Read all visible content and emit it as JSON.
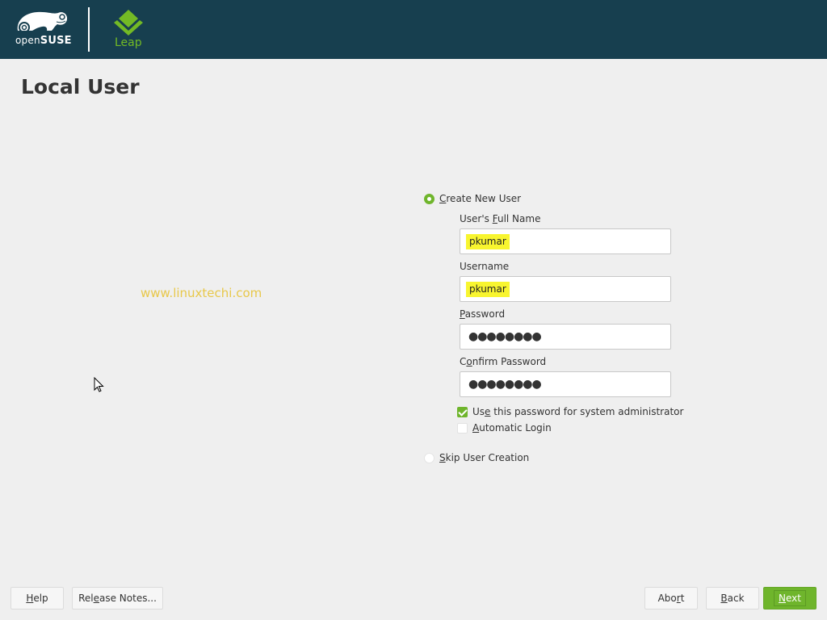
{
  "header": {
    "brand_name_prefix": "open",
    "brand_name_suffix": "SUSE",
    "product_name": "Leap",
    "background_color": "#173f4f",
    "accent_color": "#73ba25"
  },
  "page": {
    "title": "Local User",
    "watermark": "www.linuxtechi.com"
  },
  "form": {
    "create_new_user": {
      "label_mnemonic": "C",
      "label_rest": "reate New User",
      "selected": true
    },
    "full_name": {
      "label_pre": "User's ",
      "label_mnemonic": "F",
      "label_rest": "ull Name",
      "value": "pkumar"
    },
    "username": {
      "label": "Username",
      "value": "pkumar"
    },
    "password": {
      "label_mnemonic": "P",
      "label_rest": "assword",
      "masked_value": "●●●●●●●●"
    },
    "confirm_password": {
      "label_pre": "C",
      "label_mnemonic": "o",
      "label_rest": "nfirm Password",
      "masked_value": "●●●●●●●●"
    },
    "use_for_admin": {
      "label_pre": "Us",
      "label_mnemonic": "e",
      "label_rest": " this password for system administrator",
      "checked": true
    },
    "automatic_login": {
      "label_mnemonic": "A",
      "label_rest": "utomatic Login",
      "checked": false
    },
    "skip_user_creation": {
      "label_mnemonic": "S",
      "label_rest": "kip User Creation",
      "selected": false
    }
  },
  "footer": {
    "help": {
      "mnemonic": "H",
      "rest": "elp"
    },
    "release_notes": {
      "pre": "Rel",
      "mnemonic": "e",
      "rest": "ase Notes..."
    },
    "abort": {
      "pre": "Abo",
      "mnemonic": "r",
      "rest": "t"
    },
    "back": {
      "mnemonic": "B",
      "rest": "ack"
    },
    "next": {
      "mnemonic": "N",
      "rest": "ext"
    }
  }
}
